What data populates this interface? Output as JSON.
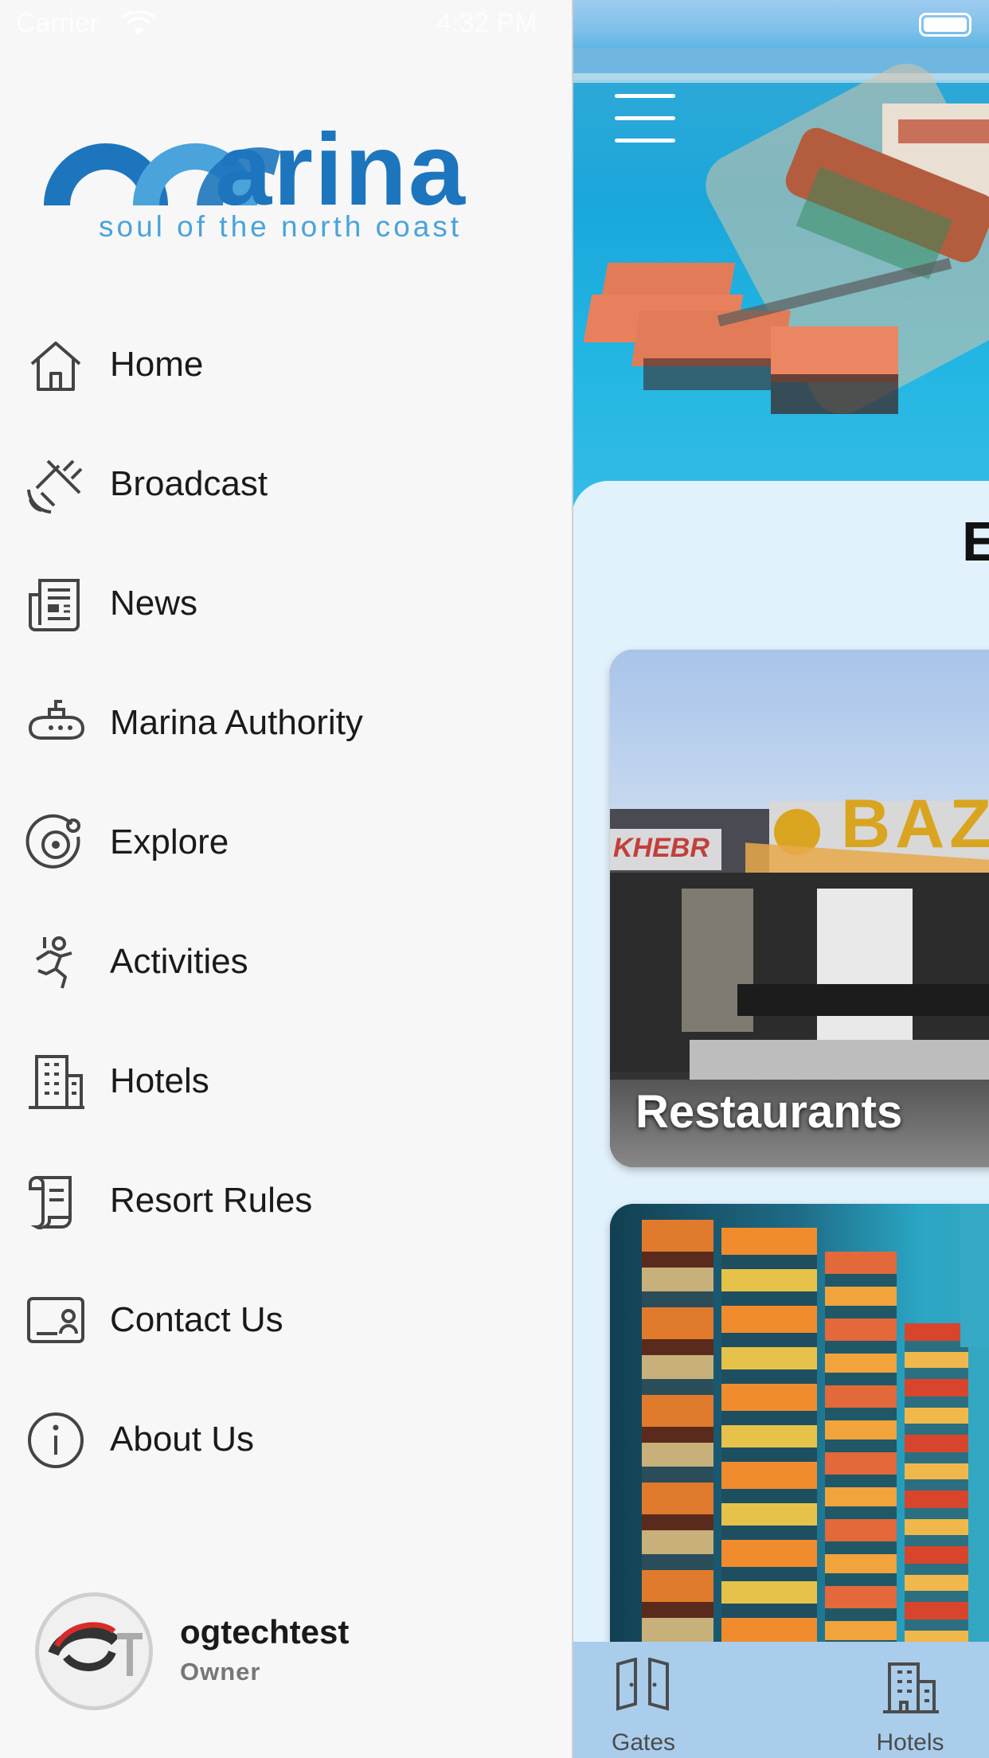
{
  "status_bar": {
    "carrier": "Carrier",
    "time": "4:32 PM"
  },
  "brand": {
    "word": "arina",
    "tagline": "soul of the north coast",
    "colors": {
      "primary": "#1d75bd",
      "light": "#4aa3da"
    }
  },
  "menu": {
    "items": [
      {
        "label": "Home",
        "icon": "home-icon"
      },
      {
        "label": "Broadcast",
        "icon": "satellite-dish-icon"
      },
      {
        "label": "News",
        "icon": "newspaper-icon"
      },
      {
        "label": "Marina Authority",
        "icon": "submarine-icon"
      },
      {
        "label": "Explore",
        "icon": "target-icon"
      },
      {
        "label": "Activities",
        "icon": "climber-icon"
      },
      {
        "label": "Hotels",
        "icon": "building-icon"
      },
      {
        "label": "Resort Rules",
        "icon": "scroll-icon"
      },
      {
        "label": "Contact Us",
        "icon": "contact-card-icon"
      },
      {
        "label": "About Us",
        "icon": "info-icon"
      }
    ]
  },
  "user": {
    "name": "ogtechtest",
    "role": "Owner",
    "avatar_text": "OT"
  },
  "main": {
    "section_title_partial": "E",
    "cards": [
      {
        "label": "Restaurants",
        "sign_text": "BAZO",
        "side_text": "KHEBR"
      },
      {
        "label": ""
      }
    ],
    "tabs": [
      {
        "label": "Gates",
        "icon": "door-icon"
      },
      {
        "label": "Hotels",
        "icon": "building-icon"
      }
    ]
  }
}
